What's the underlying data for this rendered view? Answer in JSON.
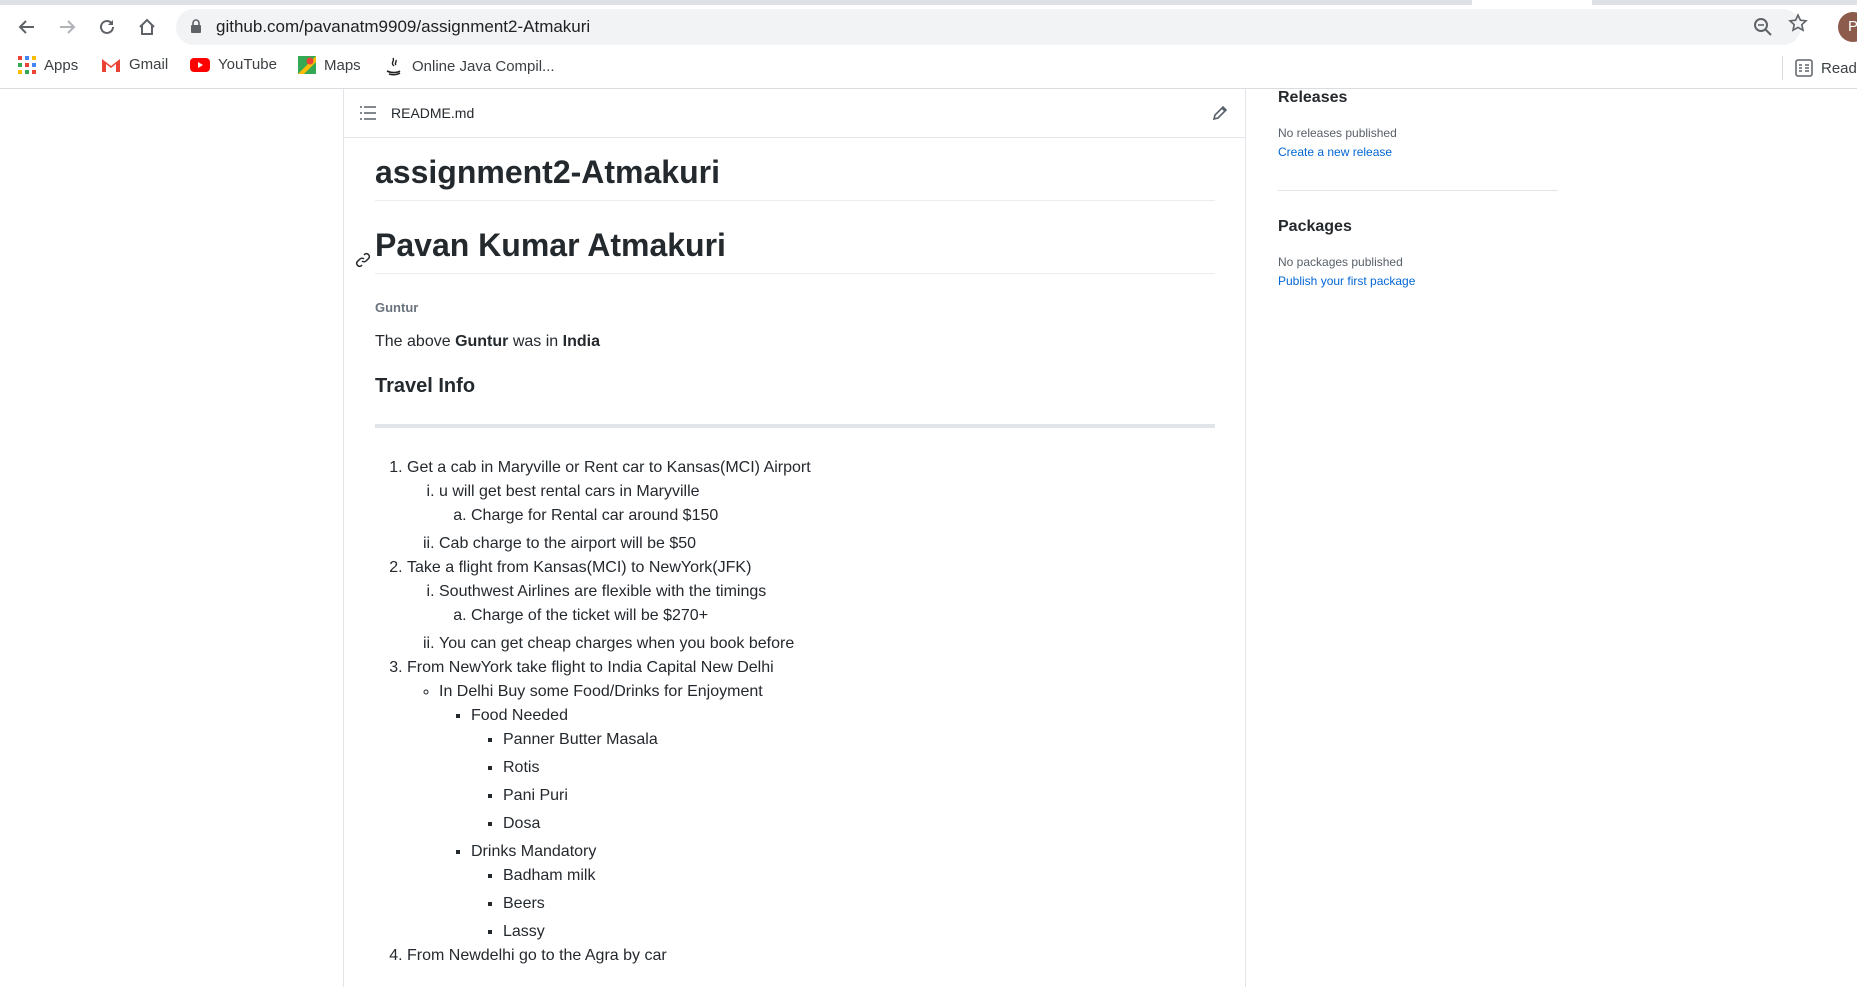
{
  "browser": {
    "url": "github.com/pavanatm9909/assignment2-Atmakuri",
    "profile_initial": "P",
    "bookmarks": [
      {
        "label": "Apps",
        "icon": "apps-grid-icon"
      },
      {
        "label": "Gmail",
        "icon": "gmail-icon"
      },
      {
        "label": "YouTube",
        "icon": "youtube-icon"
      },
      {
        "label": "Maps",
        "icon": "maps-icon"
      },
      {
        "label": "Online Java Compil...",
        "icon": "java-icon"
      }
    ],
    "reading_list_label": "Read"
  },
  "readme": {
    "filename": "README.md",
    "title": "assignment2-Atmakuri",
    "name_heading": "Pavan Kumar Atmakuri",
    "small_heading": "Guntur",
    "sentence": {
      "pre": "The above ",
      "bold1": "Guntur",
      "mid": " was in ",
      "bold2": "India"
    },
    "section_heading": "Travel Info",
    "list": {
      "item1": "Get a cab in Maryville or Rent car to Kansas(MCI) Airport",
      "item1_i": "u will get best rental cars in Maryville",
      "item1_i_a": "Charge for Rental car around $150",
      "item1_ii": "Cab charge to the airport will be $50",
      "item2": "Take a flight from Kansas(MCI) to NewYork(JFK)",
      "item2_i": "Southwest Airlines are flexible with the timings",
      "item2_i_a": "Charge of the ticket will be $270+",
      "item2_ii": "You can get cheap charges when you book before",
      "item3": "From NewYork take flight to India Capital New Delhi",
      "item3_sub": "In Delhi Buy some Food/Drinks for Enjoyment",
      "food_heading": "Food Needed",
      "foods": [
        "Panner Butter Masala",
        "Rotis",
        "Pani Puri",
        "Dosa"
      ],
      "drinks_heading": "Drinks Mandatory",
      "drinks": [
        "Badham milk",
        "Beers",
        "Lassy"
      ],
      "item4": "From Newdelhi go to the Agra by car"
    }
  },
  "sidebar": {
    "releases_heading": "Releases",
    "releases_text": "No releases published",
    "releases_link": "Create a new release",
    "packages_heading": "Packages",
    "packages_text": "No packages published",
    "packages_link": "Publish your first package"
  }
}
